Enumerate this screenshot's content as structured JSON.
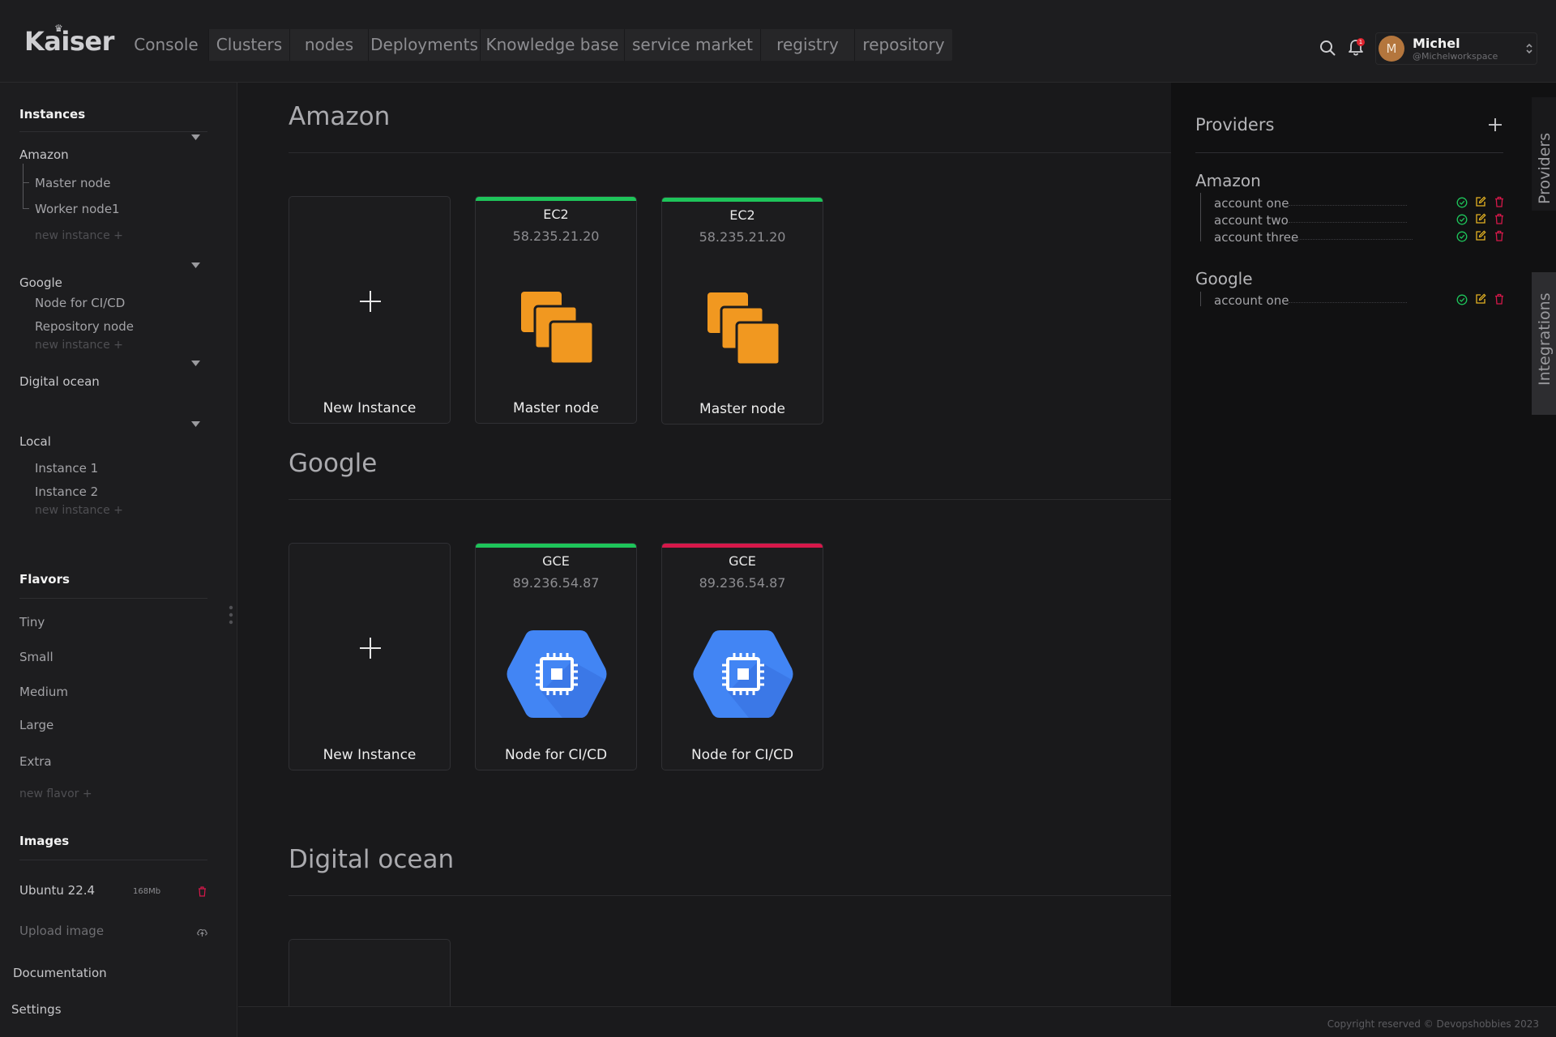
{
  "app": {
    "logo": "Kaiser",
    "nav_tabs": [
      {
        "label": "Console",
        "active": true
      },
      {
        "label": "Clusters"
      },
      {
        "label": "nodes"
      },
      {
        "label": "Deployments"
      },
      {
        "label": "Knowledge base"
      },
      {
        "label": "service market"
      },
      {
        "label": "registry"
      },
      {
        "label": "repository"
      }
    ],
    "notifications_count": "1",
    "user": {
      "initial": "M",
      "name": "Michel",
      "workspace": "@Michelworkspace"
    }
  },
  "sidebar": {
    "instances_heading": "Instances",
    "instance_groups": [
      {
        "name": "Amazon",
        "items": [
          "Master node",
          "Worker node1"
        ],
        "new_label": "new instance +"
      },
      {
        "name": "Google",
        "items": [
          "Node for CI/CD",
          "Repository node"
        ],
        "new_label": "new instance +"
      },
      {
        "name": "Digital ocean",
        "items": []
      },
      {
        "name": "Local",
        "items": [
          "Instance 1",
          "Instance 2"
        ],
        "new_label": "new instance +"
      }
    ],
    "flavors_heading": "Flavors",
    "flavors": [
      "Tiny",
      "Small",
      "Medium",
      "Large",
      "Extra"
    ],
    "new_flavor": "new flavor +",
    "images_heading": "Images",
    "images": [
      {
        "name": "Ubuntu 22.4",
        "size": "168Mb"
      }
    ],
    "upload_image": "Upload image",
    "documentation": "Documentation",
    "settings": "Settings"
  },
  "main": {
    "sections": [
      {
        "title": "Amazon",
        "cards": [
          {
            "kind": "new",
            "label": "New Instance"
          },
          {
            "kind": "instance",
            "type": "EC2",
            "ip": "58.235.21.20",
            "label": "Master node",
            "status_color": "#1ec45a",
            "icon": "ec2-instances-icon"
          },
          {
            "kind": "instance",
            "type": "EC2",
            "ip": "58.235.21.20",
            "label": "Master node",
            "status_color": "#1ec45a",
            "icon": "ec2-instances-icon"
          }
        ]
      },
      {
        "title": "Google",
        "cards": [
          {
            "kind": "new",
            "label": "New Instance"
          },
          {
            "kind": "instance",
            "type": "GCE",
            "ip": "89.236.54.87",
            "label": "Node for CI/CD",
            "status_color": "#1ec45a",
            "icon": "gce-chip-icon"
          },
          {
            "kind": "instance",
            "type": "GCE",
            "ip": "89.236.54.87",
            "label": "Node for CI/CD",
            "status_color": "#d6184a",
            "icon": "gce-chip-icon"
          }
        ]
      },
      {
        "title": "Digital ocean",
        "cards": []
      }
    ]
  },
  "providers": {
    "title": "Providers",
    "groups": [
      {
        "name": "Amazon",
        "accounts": [
          "account one",
          "account two",
          "account three"
        ]
      },
      {
        "name": "Google",
        "accounts": [
          "account one"
        ]
      }
    ]
  },
  "rail": {
    "providers_tab": "Providers",
    "integrations_tab": "Integrations"
  },
  "footer": {
    "copyright": "Copyright reserved © Devopshobbies 2023"
  },
  "colors": {
    "accent_green": "#1ec45a",
    "accent_red": "#d6184a",
    "aws_orange": "#f19820",
    "gcp_blue": "#4285f4"
  }
}
